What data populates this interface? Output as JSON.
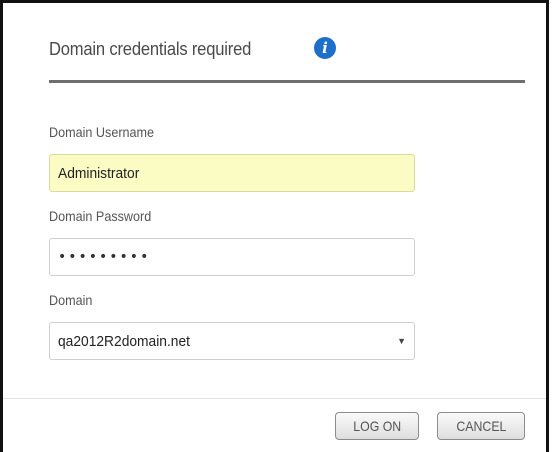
{
  "dialog": {
    "title": "Domain credentials required",
    "info_icon": "info-icon",
    "fields": {
      "username": {
        "label": "Domain Username",
        "value": "Administrator"
      },
      "password": {
        "label": "Domain Password",
        "masked_value": "•••••••••"
      },
      "domain": {
        "label": "Domain",
        "selected": "qa2012R2domain.net"
      }
    },
    "buttons": {
      "logon": "LOG ON",
      "cancel": "CANCEL"
    }
  },
  "colors": {
    "info_icon": "#1e6fc8",
    "autofill_bg": "#fafcc4",
    "header_rule": "#6e6e6e"
  }
}
